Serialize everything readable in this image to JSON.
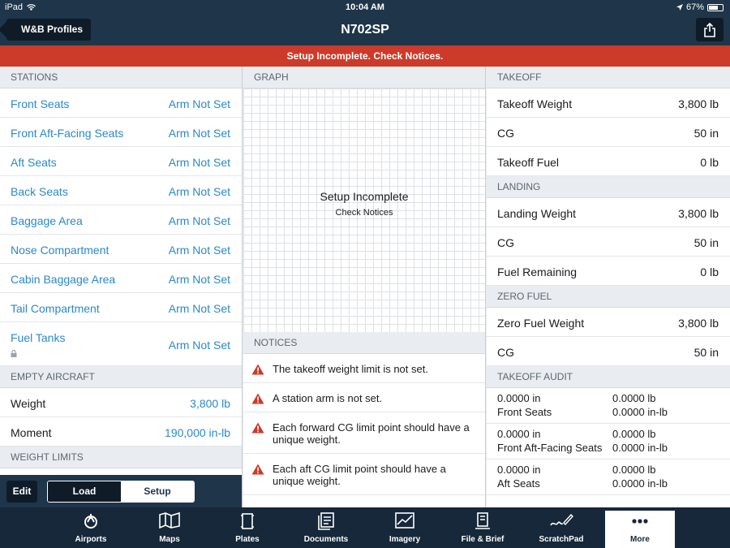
{
  "status": {
    "carrier": "iPad",
    "time": "10:04 AM",
    "battery": "67%",
    "battery_level": 0.67
  },
  "nav": {
    "back_label": "W&B Profiles",
    "title": "N702SP"
  },
  "banner": "Setup Incomplete. Check Notices.",
  "stations": {
    "header": "STATIONS",
    "items": [
      {
        "name": "Front Seats",
        "value": "Arm Not Set"
      },
      {
        "name": "Front Aft-Facing Seats",
        "value": "Arm Not Set"
      },
      {
        "name": "Aft Seats",
        "value": "Arm Not Set"
      },
      {
        "name": "Back Seats",
        "value": "Arm Not Set"
      },
      {
        "name": "Baggage Area",
        "value": "Arm Not Set"
      },
      {
        "name": "Nose Compartment",
        "value": "Arm Not Set"
      },
      {
        "name": "Cabin Baggage Area",
        "value": "Arm Not Set"
      },
      {
        "name": "Tail Compartment",
        "value": "Arm Not Set"
      },
      {
        "name": "Fuel Tanks",
        "value": "Arm Not Set"
      }
    ]
  },
  "empty_aircraft": {
    "header": "EMPTY AIRCRAFT",
    "weight_label": "Weight",
    "weight_value": "3,800 lb",
    "moment_label": "Moment",
    "moment_value": "190,000 in-lb"
  },
  "weight_limits": {
    "header": "WEIGHT LIMITS"
  },
  "bottom": {
    "edit": "Edit",
    "load": "Load",
    "setup": "Setup"
  },
  "graph": {
    "header": "GRAPH",
    "title": "Setup Incomplete",
    "subtitle": "Check Notices"
  },
  "notices": {
    "header": "NOTICES",
    "items": [
      "The takeoff weight limit is not set.",
      "A station arm is not set.",
      "Each forward CG limit point should have a unique weight.",
      "Each aft CG limit point should have a unique weight."
    ]
  },
  "takeoff": {
    "header": "TAKEOFF",
    "rows": [
      {
        "label": "Takeoff Weight",
        "value": "3,800 lb"
      },
      {
        "label": "CG",
        "value": "50 in"
      },
      {
        "label": "Takeoff Fuel",
        "value": "0 lb"
      }
    ]
  },
  "landing": {
    "header": "LANDING",
    "rows": [
      {
        "label": "Landing Weight",
        "value": "3,800 lb"
      },
      {
        "label": "CG",
        "value": "50 in"
      },
      {
        "label": "Fuel Remaining",
        "value": "0 lb"
      }
    ]
  },
  "zero_fuel": {
    "header": "ZERO FUEL",
    "rows": [
      {
        "label": "Zero Fuel Weight",
        "value": "3,800 lb"
      },
      {
        "label": "CG",
        "value": "50 in"
      }
    ]
  },
  "takeoff_audit": {
    "header": "TAKEOFF AUDIT",
    "rows": [
      {
        "arm": "0.0000 in",
        "weight": "0.0000 lb",
        "station": "Front Seats",
        "moment": "0.0000 in-lb"
      },
      {
        "arm": "0.0000 in",
        "weight": "0.0000 lb",
        "station": "Front Aft-Facing Seats",
        "moment": "0.0000 in-lb"
      },
      {
        "arm": "0.0000 in",
        "weight": "0.0000 lb",
        "station": "Aft Seats",
        "moment": "0.0000 in-lb"
      }
    ]
  },
  "tabs": [
    {
      "label": "Airports",
      "icon": "airport-icon"
    },
    {
      "label": "Maps",
      "icon": "map-icon"
    },
    {
      "label": "Plates",
      "icon": "plates-icon"
    },
    {
      "label": "Documents",
      "icon": "documents-icon"
    },
    {
      "label": "Imagery",
      "icon": "imagery-icon"
    },
    {
      "label": "File & Brief",
      "icon": "file-brief-icon"
    },
    {
      "label": "ScratchPad",
      "icon": "scratchpad-icon"
    },
    {
      "label": "More",
      "icon": "more-icon",
      "active": true
    }
  ],
  "colors": {
    "nav": "#1f3549",
    "banner": "#cc3b2a",
    "link": "#2b88c9",
    "warning": "#cc3b2a"
  }
}
